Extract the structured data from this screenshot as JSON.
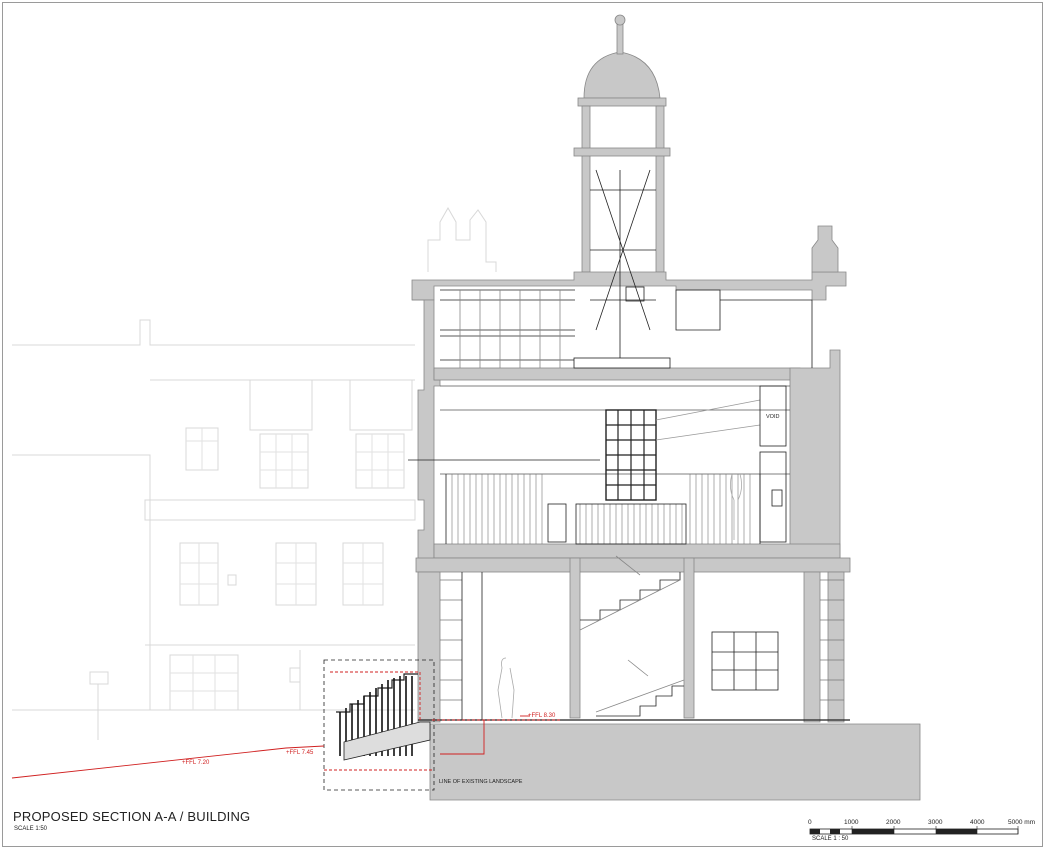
{
  "drawing": {
    "title": "PROPOSED SECTION A-A / BUILDING",
    "scale_note": "SCALE 1:50"
  },
  "levels": [
    {
      "label": "+FFL 7.20"
    },
    {
      "label": "+FFL 7.45"
    },
    {
      "label": "+FFL 8.30"
    }
  ],
  "annotations": {
    "existing_landscape": "LINE OF EXISTING LANDSCAPE",
    "void": "VOID"
  },
  "scale_bar": {
    "ticks": [
      "0",
      "1000",
      "2000",
      "3000",
      "4000",
      "5000 mm"
    ],
    "caption": "SCALE  1 : 50"
  },
  "colors": {
    "section_fill": "#c8c8c8",
    "line": "#111111",
    "faded": "#dcdcdc",
    "level_marker": "#d02020"
  }
}
